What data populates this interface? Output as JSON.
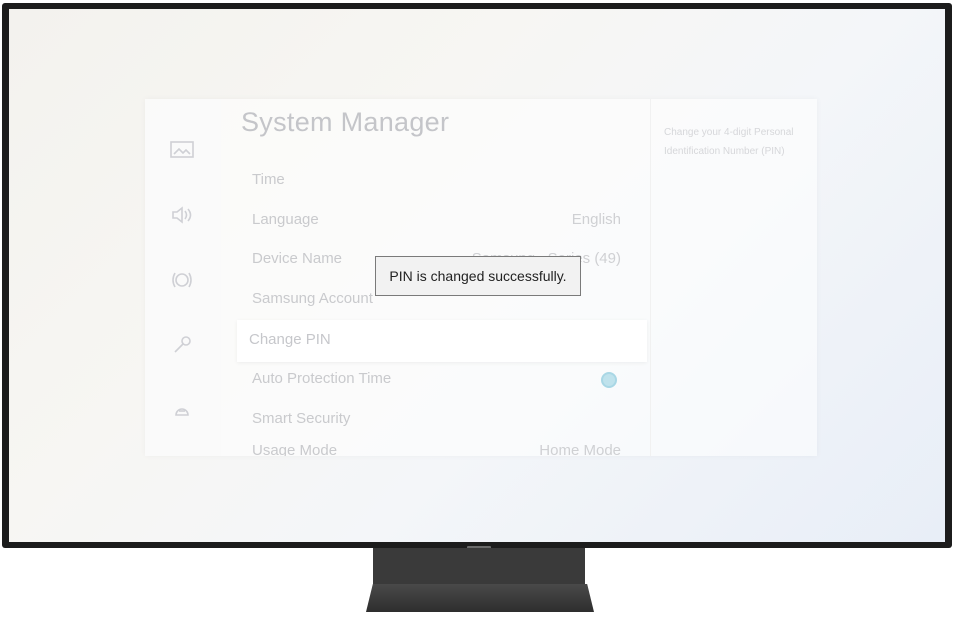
{
  "screen": {
    "title": "System Manager",
    "menu_items": [
      {
        "label": "Time",
        "value": ""
      },
      {
        "label": "Language",
        "value": "English"
      },
      {
        "label": "Device Name",
        "value": "Samsung _Series (49)"
      },
      {
        "label": "Samsung Account",
        "value": ""
      },
      {
        "label": "Change PIN",
        "value": ""
      },
      {
        "label": "Auto Protection Time",
        "value": ""
      },
      {
        "label": "Smart Security",
        "value": ""
      },
      {
        "label": "Usage Mode",
        "value": "Home Mode"
      }
    ],
    "help_text": "Change your 4-digit Personal Identification Number (PIN)",
    "toast": "PIN is changed successfully."
  },
  "rail_icons": [
    "picture-icon",
    "sound-icon",
    "broadcasting-icon",
    "general-icon",
    "support-icon"
  ],
  "colors": {
    "accent_toggle": "#bfe2ec",
    "toast_bg": "#f2f2f2"
  }
}
